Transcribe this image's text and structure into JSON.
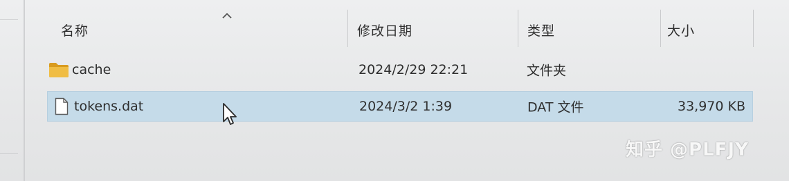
{
  "columns": {
    "name": "名称",
    "modified": "修改日期",
    "type": "类型",
    "size": "大小"
  },
  "files": [
    {
      "name": "cache",
      "modified": "2024/2/29 22:21",
      "type": "文件夹",
      "size": "",
      "icon": "folder-icon",
      "selected": false
    },
    {
      "name": "tokens.dat",
      "modified": "2024/3/2 1:39",
      "type": "DAT 文件",
      "size": "33,970 KB",
      "icon": "file-icon",
      "selected": true
    }
  ],
  "sort": {
    "column": "name",
    "direction": "ascending"
  },
  "watermark": "知乎 @PLFJY",
  "colors": {
    "selection": "#c5dbe9",
    "folder": "#e8b33a"
  }
}
